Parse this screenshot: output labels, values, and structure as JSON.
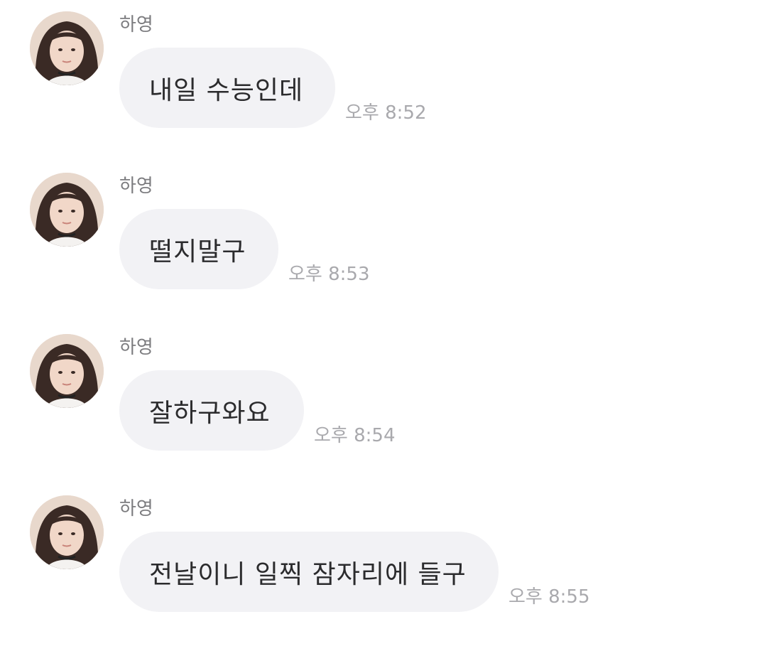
{
  "messages": [
    {
      "sender": "하영",
      "text": "내일 수능인데",
      "time": "오후 8:52"
    },
    {
      "sender": "하영",
      "text": "떨지말구",
      "time": "오후 8:53"
    },
    {
      "sender": "하영",
      "text": "잘하구와요",
      "time": "오후 8:54"
    },
    {
      "sender": "하영",
      "text": "전날이니 일찍 잠자리에 들구",
      "time": "오후 8:55"
    }
  ],
  "colors": {
    "background": "#ffffff",
    "bubble": "#f2f2f5",
    "message_text": "#2b2b2d",
    "sender_text": "#7c7c7f",
    "time_text": "#a9a9ad"
  },
  "icons": {
    "avatar": "profile-photo-avatar"
  }
}
